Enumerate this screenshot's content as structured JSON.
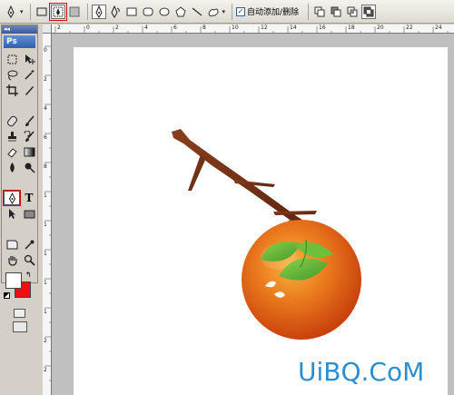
{
  "options_bar": {
    "auto_add_delete_label": "自动添加/删除",
    "auto_add_delete_checked": "✓"
  },
  "tools": {
    "header_glyph": "◂◂",
    "logo": "Ps",
    "type_tool_glyph": "T",
    "foreground_color": "#ffffff",
    "background_color": "#ee1010"
  },
  "rulers": {
    "horizontal_labels": [
      "2",
      "0",
      "2",
      "4",
      "6",
      "8",
      "10",
      "12",
      "14",
      "16",
      "18",
      "20",
      "22",
      "24"
    ],
    "vertical_labels": [
      "0",
      "2",
      "4",
      "6",
      "8",
      "1",
      "1",
      "1",
      "1",
      "1",
      "2",
      "2"
    ]
  },
  "watermark": {
    "text": "UiBQ.CoM",
    "color": "#2a8fd0"
  },
  "colors": {
    "persimmon_orange": "#e85a10",
    "leaf_green": "#5fb53a",
    "branch_brown": "#6b2e14"
  }
}
